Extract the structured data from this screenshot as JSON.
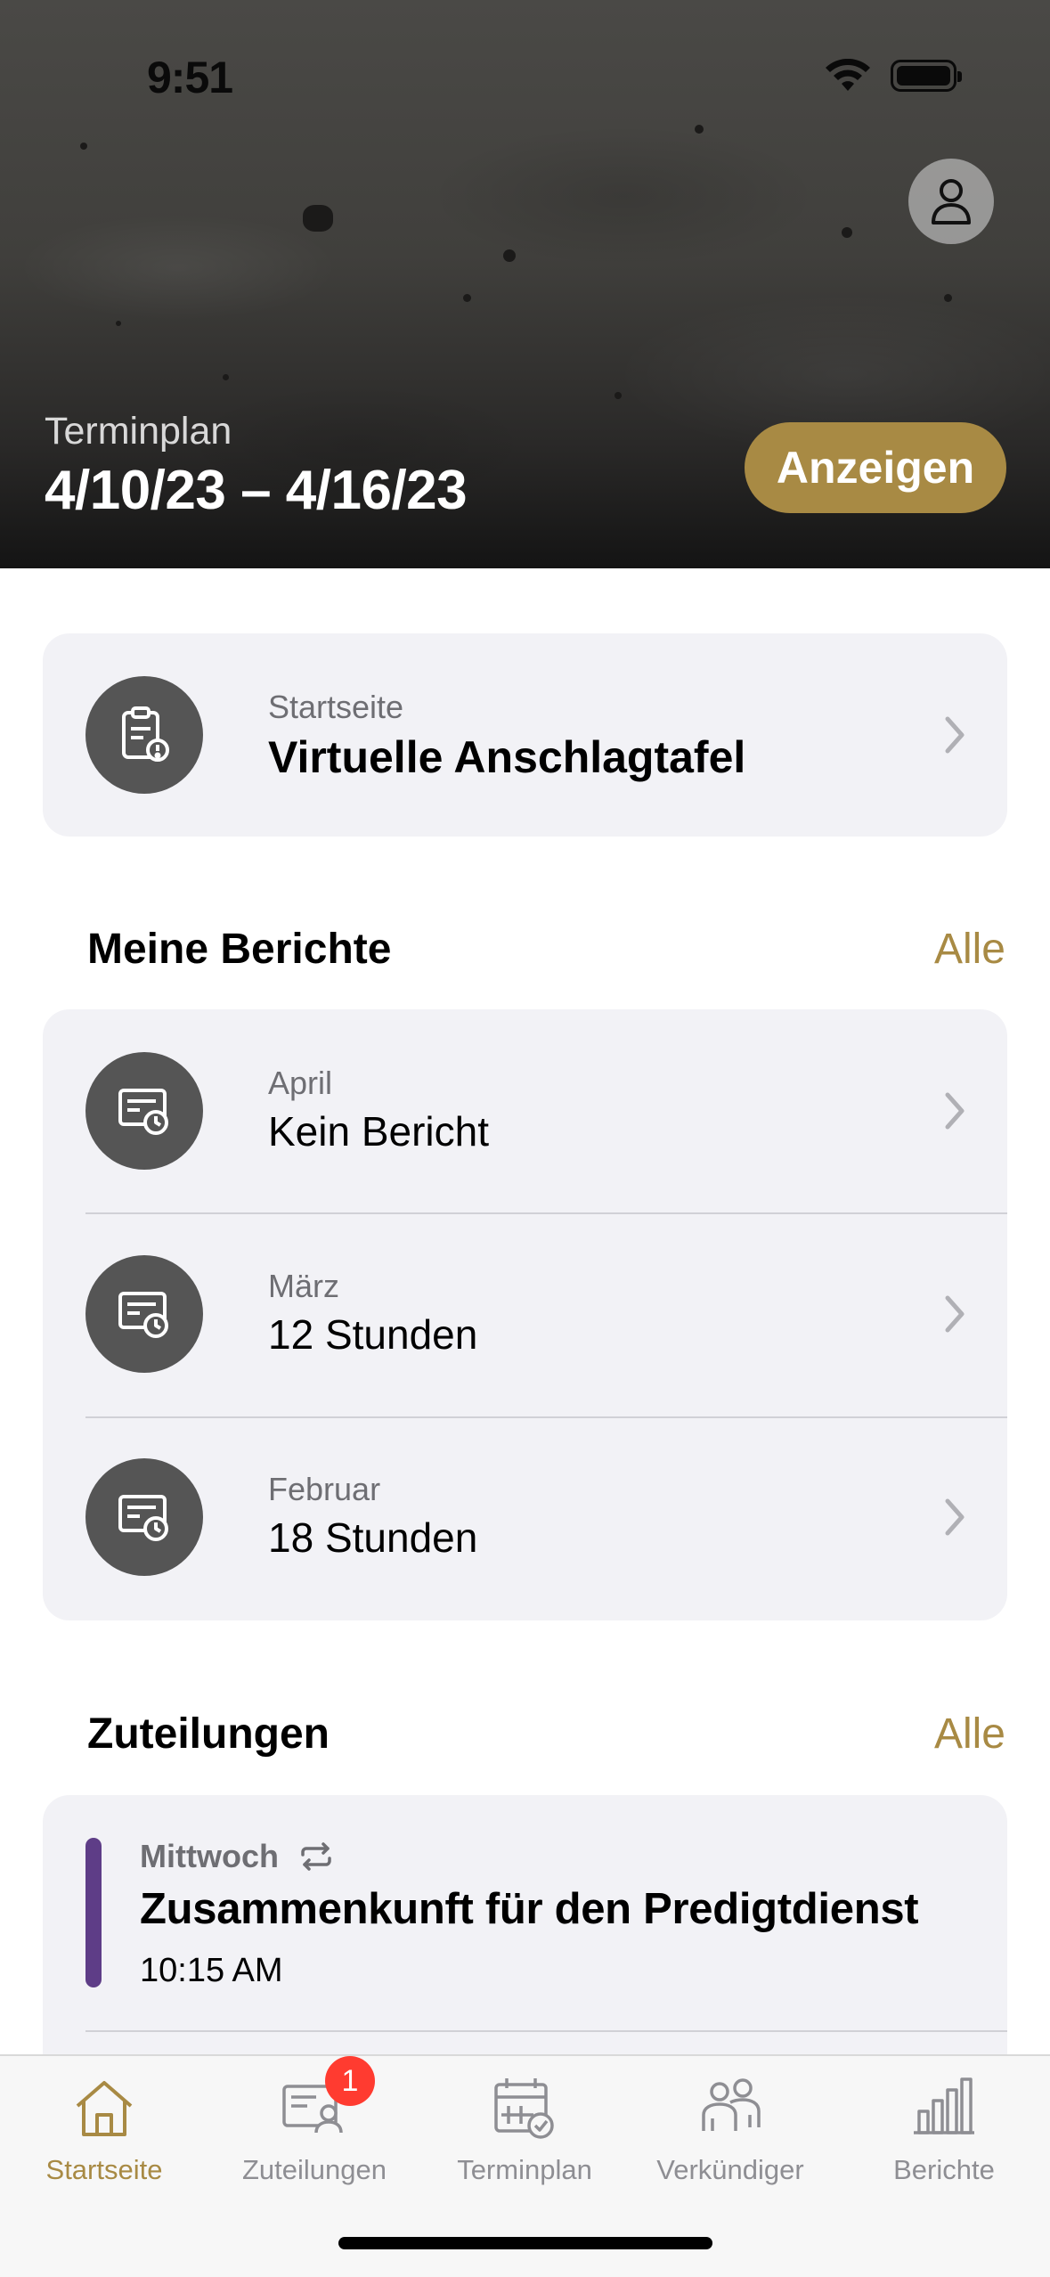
{
  "status_bar": {
    "time": "9:51"
  },
  "hero": {
    "label": "Terminplan",
    "date_range": "4/10/23 – 4/16/23",
    "show_button": "Anzeigen"
  },
  "bulletin": {
    "subtitle": "Startseite",
    "title": "Virtuelle Anschlagtafel"
  },
  "reports": {
    "section_title": "Meine Berichte",
    "all_link": "Alle",
    "items": [
      {
        "month": "April",
        "value": "Kein Bericht"
      },
      {
        "month": "März",
        "value": "12 Stunden"
      },
      {
        "month": "Februar",
        "value": "18 Stunden"
      }
    ]
  },
  "assignments": {
    "section_title": "Zuteilungen",
    "all_link": "Alle",
    "items": [
      {
        "day": "Mittwoch",
        "title": "Zusammenkunft für den Predigtdienst",
        "time": "10:15 AM",
        "color": "#5e3d87"
      }
    ]
  },
  "tabbar": {
    "tabs": [
      {
        "label": "Startseite",
        "icon": "house-icon",
        "active": true
      },
      {
        "label": "Zuteilungen",
        "icon": "assignments-icon",
        "badge": "1"
      },
      {
        "label": "Terminplan",
        "icon": "calendar-check-icon"
      },
      {
        "label": "Verkündiger",
        "icon": "people-icon"
      },
      {
        "label": "Berichte",
        "icon": "bar-chart-icon"
      }
    ]
  },
  "colors": {
    "accent": "#a88a44",
    "card": "#f2f2f6",
    "icon_circle": "#555555",
    "badge": "#ff3b30"
  }
}
